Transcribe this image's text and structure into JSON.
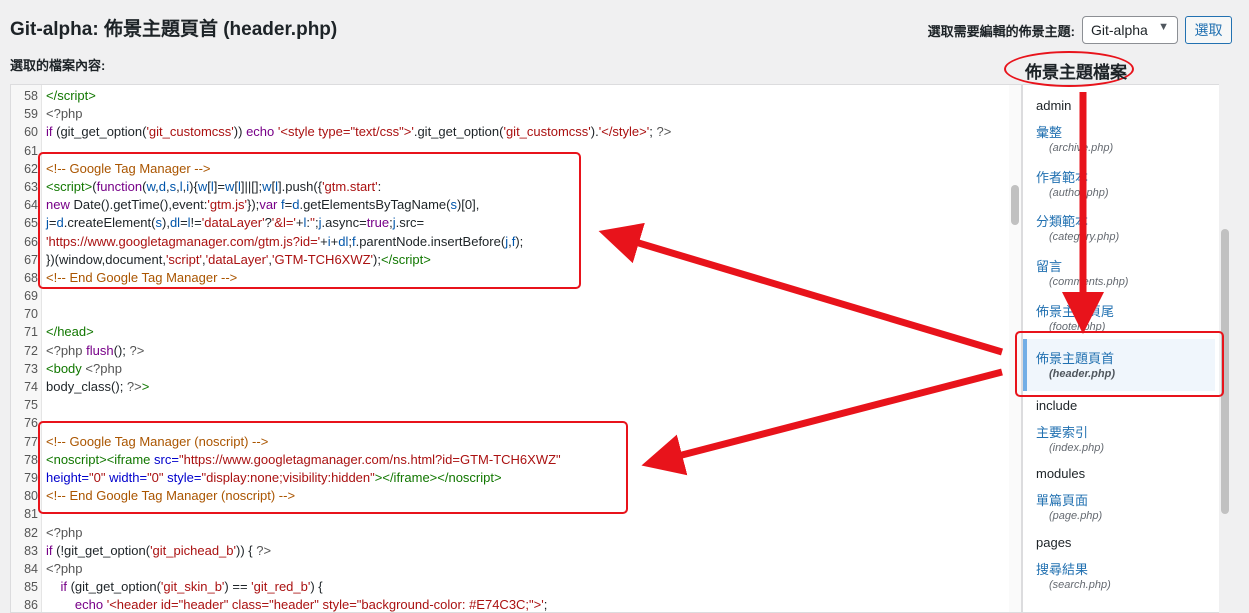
{
  "header": {
    "title": "Git-alpha: 佈景主題頁首 (header.php)",
    "subtitle": "選取的檔案內容:",
    "theme_select_label": "選取需要編輯的佈景主題:",
    "theme_select_value": "Git-alpha",
    "select_button": "選取"
  },
  "annotation": {
    "label": "佈景主題檔案"
  },
  "editor": {
    "lines": [
      {
        "n": "58",
        "html": "<span class='t-tag'>&lt;/script&gt;</span>"
      },
      {
        "n": "59",
        "html": "<span class='t-php'>&lt;?php</span>"
      },
      {
        "n": "60",
        "html": "<span class='t-kw'>if</span> (git_get_option(<span class='t-str'>'git_customcss'</span>)) <span class='t-kw'>echo</span> <span class='t-str'>'&lt;style type=\"text/css\"&gt;'</span>.git_get_option(<span class='t-str'>'git_customcss'</span>).<span class='t-str'>'&lt;/style&gt;'</span>; <span class='t-php'>?&gt;</span>"
      },
      {
        "n": "61",
        "html": ""
      },
      {
        "n": "62",
        "html": "<span class='t-cm'>&lt;!-- Google Tag Manager --&gt;</span>"
      },
      {
        "n": "63",
        "html": "<span class='t-tag'>&lt;script&gt;</span>(<span class='t-kw'>function</span>(<span class='t-var'>w</span>,<span class='t-var'>d</span>,<span class='t-var'>s</span>,<span class='t-var'>l</span>,<span class='t-var'>i</span>){<span class='t-var'>w</span>[<span class='t-var'>l</span>]=<span class='t-var'>w</span>[<span class='t-var'>l</span>]||[];<span class='t-var'>w</span>[<span class='t-var'>l</span>].push({<span class='t-str'>'gtm.start'</span>:"
      },
      {
        "n": "64",
        "html": "<span class='t-kw'>new</span> Date().getTime(),event:<span class='t-str'>'gtm.js'</span>});<span class='t-kw'>var</span> <span class='t-var'>f</span>=<span class='t-var'>d</span>.getElementsByTagName(<span class='t-var'>s</span>)[0],"
      },
      {
        "n": "65",
        "html": "<span class='t-var'>j</span>=<span class='t-var'>d</span>.createElement(<span class='t-var'>s</span>),<span class='t-var'>dl</span>=<span class='t-var'>l</span>!=<span class='t-str'>'dataLayer'</span>?<span class='t-str'>'&amp;l='</span>+<span class='t-var'>l</span>:<span class='t-str'>''</span>;<span class='t-var'>j</span>.async=<span class='t-kw'>true</span>;<span class='t-var'>j</span>.src="
      },
      {
        "n": "66",
        "html": "<span class='t-str'>'https://www.googletagmanager.com/gtm.js?id='</span>+<span class='t-var'>i</span>+<span class='t-var'>dl</span>;<span class='t-var'>f</span>.parentNode.insertBefore(<span class='t-var'>j</span>,<span class='t-var'>f</span>);"
      },
      {
        "n": "67",
        "html": "})(window,document,<span class='t-str'>'script'</span>,<span class='t-str'>'dataLayer'</span>,<span class='t-str'>'GTM-TCH6XWZ'</span>);<span class='t-tag'>&lt;/script&gt;</span>"
      },
      {
        "n": "68",
        "html": "<span class='t-cm'>&lt;!-- End Google Tag Manager --&gt;</span>"
      },
      {
        "n": "69",
        "html": ""
      },
      {
        "n": "70",
        "html": ""
      },
      {
        "n": "71",
        "html": "<span class='t-tag'>&lt;/head&gt;</span>"
      },
      {
        "n": "72",
        "html": "<span class='t-php'>&lt;?php</span> <span class='t-kw'>flush</span>(); <span class='t-php'>?&gt;</span>"
      },
      {
        "n": "73",
        "html": "<span class='t-tag'>&lt;body</span> <span class='t-php'>&lt;?php</span>"
      },
      {
        "n": "74",
        "html": "body_class(); <span class='t-php'>?&gt;</span><span class='t-tag'>&gt;</span>"
      },
      {
        "n": "75",
        "html": ""
      },
      {
        "n": "76",
        "html": ""
      },
      {
        "n": "77",
        "html": "<span class='t-cm'>&lt;!-- Google Tag Manager (noscript) --&gt;</span>"
      },
      {
        "n": "78",
        "html": "<span class='t-tag'>&lt;noscript&gt;&lt;iframe</span> <span class='t-attr'>src=</span><span class='t-str'>\"https://www.googletagmanager.com/ns.html?id=GTM-TCH6XWZ\"</span>"
      },
      {
        "n": "79",
        "html": "<span class='t-attr'>height=</span><span class='t-str'>\"0\"</span> <span class='t-attr'>width=</span><span class='t-str'>\"0\"</span> <span class='t-attr'>style=</span><span class='t-str'>\"display:none;visibility:hidden\"</span><span class='t-tag'>&gt;&lt;/iframe&gt;&lt;/noscript&gt;</span>"
      },
      {
        "n": "80",
        "html": "<span class='t-cm'>&lt;!-- End Google Tag Manager (noscript) --&gt;</span>"
      },
      {
        "n": "81",
        "html": ""
      },
      {
        "n": "82",
        "html": "<span class='t-php'>&lt;?php</span>"
      },
      {
        "n": "83",
        "html": "<span class='t-kw'>if</span> (!git_get_option(<span class='t-str'>'git_pichead_b'</span>)) { <span class='t-php'>?&gt;</span>"
      },
      {
        "n": "84",
        "html": "<span class='t-php'>&lt;?php</span>"
      },
      {
        "n": "85",
        "html": "    <span class='t-kw'>if</span> (git_get_option(<span class='t-str'>'git_skin_b'</span>) == <span class='t-str'>'git_red_b'</span>) {"
      },
      {
        "n": "86",
        "html": "        <span class='t-kw'>echo</span> <span class='t-str'>'&lt;header id=\"header\" class=\"header\" style=\"background-color: #E74C3C;\"&gt;'</span>;"
      }
    ]
  },
  "sidebar": {
    "items": [
      {
        "type": "heading",
        "label": "admin"
      },
      {
        "type": "link",
        "label": "彙整",
        "file": "(archive.php)"
      },
      {
        "type": "link",
        "label": "作者範本",
        "file": "(author.php)"
      },
      {
        "type": "link",
        "label": "分類範本",
        "file": "(category.php)"
      },
      {
        "type": "link",
        "label": "留言",
        "file": "(comments.php)"
      },
      {
        "type": "link",
        "label": "佈景主題頁尾",
        "file": "(footer.php)"
      },
      {
        "type": "active",
        "label": "佈景主題頁首",
        "file": "(header.php)"
      },
      {
        "type": "heading",
        "label": "include"
      },
      {
        "type": "link",
        "label": "主要索引",
        "file": "(index.php)"
      },
      {
        "type": "heading",
        "label": "modules"
      },
      {
        "type": "link",
        "label": "單篇頁面",
        "file": "(page.php)"
      },
      {
        "type": "heading",
        "label": "pages"
      },
      {
        "type": "link",
        "label": "搜尋結果",
        "file": "(search.php)"
      }
    ]
  },
  "colors": {
    "annotation_red": "#e8131b",
    "link_blue": "#2271b1"
  }
}
